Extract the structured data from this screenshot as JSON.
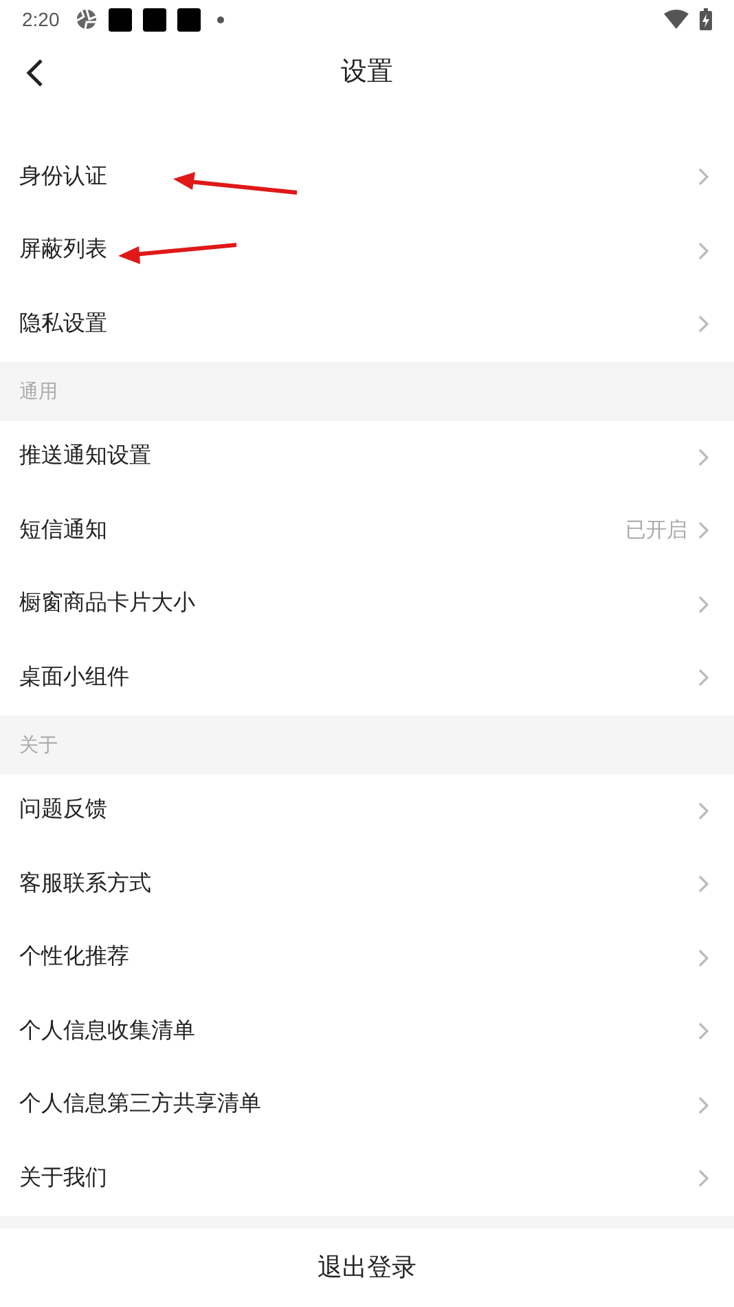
{
  "status_bar": {
    "time": "2:20"
  },
  "header": {
    "title": "设置"
  },
  "sections": [
    {
      "items": [
        {
          "label": "身份认证"
        },
        {
          "label": "屏蔽列表"
        },
        {
          "label": "隐私设置"
        }
      ]
    },
    {
      "title": "通用",
      "items": [
        {
          "label": "推送通知设置"
        },
        {
          "label": "短信通知",
          "value": "已开启"
        },
        {
          "label": "橱窗商品卡片大小"
        },
        {
          "label": "桌面小组件"
        }
      ]
    },
    {
      "title": "关于",
      "items": [
        {
          "label": "问题反馈"
        },
        {
          "label": "客服联系方式"
        },
        {
          "label": "个性化推荐"
        },
        {
          "label": "个人信息收集清单"
        },
        {
          "label": "个人信息第三方共享清单"
        },
        {
          "label": "关于我们"
        }
      ]
    }
  ],
  "logout_button": {
    "label": "退出登录"
  }
}
